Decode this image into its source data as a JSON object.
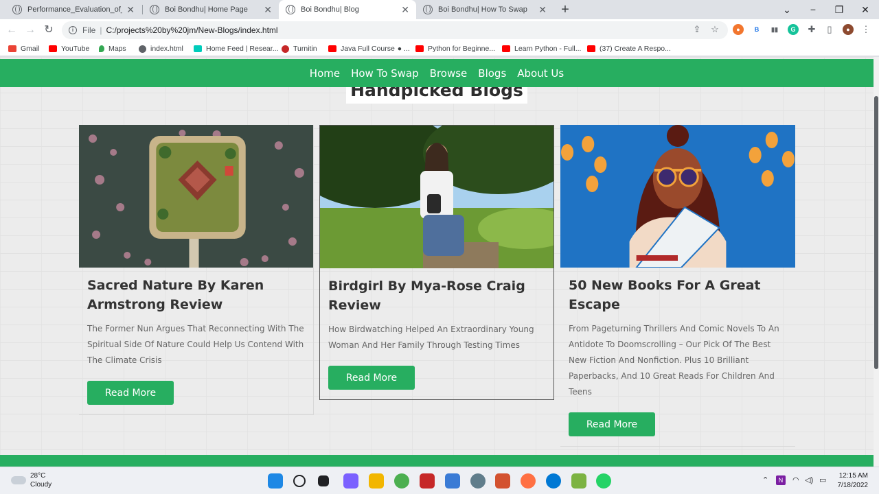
{
  "browser": {
    "tabs": [
      {
        "title": "Performance_Evaluation_of_Vario",
        "active": false
      },
      {
        "title": "Boi Bondhu| Home Page",
        "active": false
      },
      {
        "title": "Boi Bondhu| Blog",
        "active": true
      },
      {
        "title": "Boi Bondhu| How To Swap",
        "active": false
      }
    ],
    "address": {
      "scheme": "File",
      "url": "C:/projects%20by%20jm/New-Blogs/index.html"
    },
    "bookmarks": [
      {
        "label": "Gmail",
        "color": "#ea4335"
      },
      {
        "label": "YouTube",
        "color": "#ff0000"
      },
      {
        "label": "Maps",
        "color": "#34a853"
      },
      {
        "label": "index.html",
        "color": "#5f6368"
      },
      {
        "label": "Home Feed | Resear...",
        "color": "#00ccbb"
      },
      {
        "label": "Turnitin",
        "color": "#c62828"
      },
      {
        "label": "Java Full Course",
        "color": "#ff0000"
      },
      {
        "label": "Python for Beginne...",
        "color": "#ff0000"
      },
      {
        "label": "Learn Python - Full...",
        "color": "#ff0000"
      },
      {
        "label": "(37) Create A Respo...",
        "color": "#ff0000"
      }
    ]
  },
  "site": {
    "nav": [
      "Home",
      "How To Swap",
      "Browse",
      "Blogs",
      "About Us"
    ],
    "section_title": "Handpicked Blogs",
    "accent": "#27ae60",
    "cards": [
      {
        "title": "Sacred Nature By Karen Armstrong Review",
        "description": "The Former Nun Argues That Reconnecting With The Spiritual Side Of Nature Could Help Us Contend With The Climate Crisis",
        "button": "Read More"
      },
      {
        "title": "Birdgirl By Mya-Rose Craig Review",
        "description": "How Birdwatching Helped An Extraordinary Young Woman And Her Family Through Testing Times",
        "button": "Read More"
      },
      {
        "title": "50 New Books For A Great Escape",
        "description": "From Pageturning Thrillers And Comic Novels To An Antidote To Doomscrolling – Our Pick Of The Best New Fiction And Nonfiction. Plus 10 Brilliant Paperbacks, And 10 Great Reads For Children And Teens",
        "button": "Read More"
      }
    ]
  },
  "taskbar": {
    "weather": {
      "temp": "28°C",
      "condition": "Cloudy"
    },
    "time": "12:15 AM",
    "date": "7/18/2022"
  }
}
